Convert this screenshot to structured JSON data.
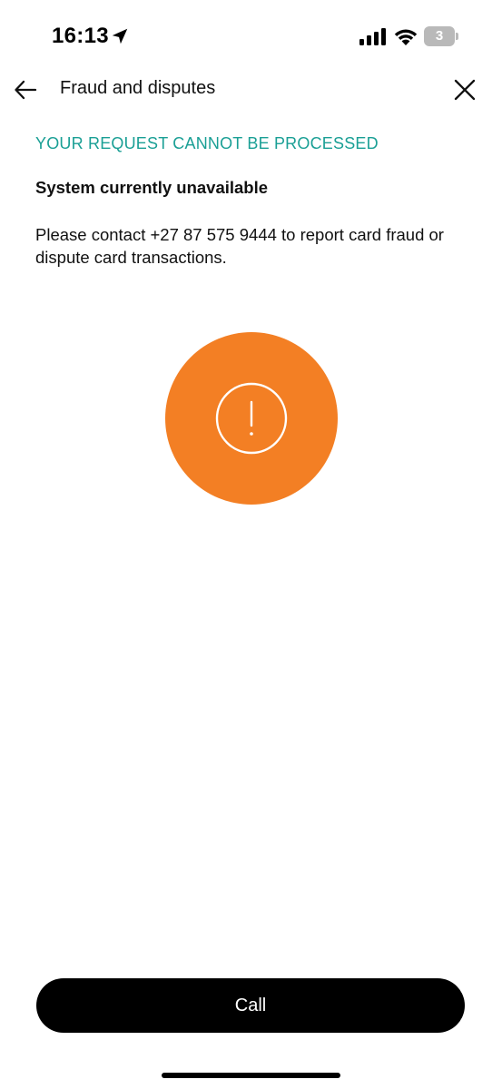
{
  "status_bar": {
    "time": "16:13",
    "battery_level": "3",
    "icons": [
      "location-arrow-icon",
      "cellular-signal-icon",
      "wifi-icon",
      "battery-icon"
    ]
  },
  "header": {
    "title": "Fraud and disputes",
    "back_icon": "arrow-left-icon",
    "close_icon": "close-icon"
  },
  "error": {
    "heading": "YOUR REQUEST CANNOT BE PROCESSED",
    "subtitle": "System currently unavailable",
    "message": "Please contact +27 87 575 9444 to report card fraud or dispute card transactions.",
    "icon": "exclamation-circle-icon"
  },
  "actions": {
    "call_label": "Call"
  },
  "colors": {
    "accent_teal": "#1a9f95",
    "alert_orange": "#f37f24",
    "button_black": "#000000"
  }
}
